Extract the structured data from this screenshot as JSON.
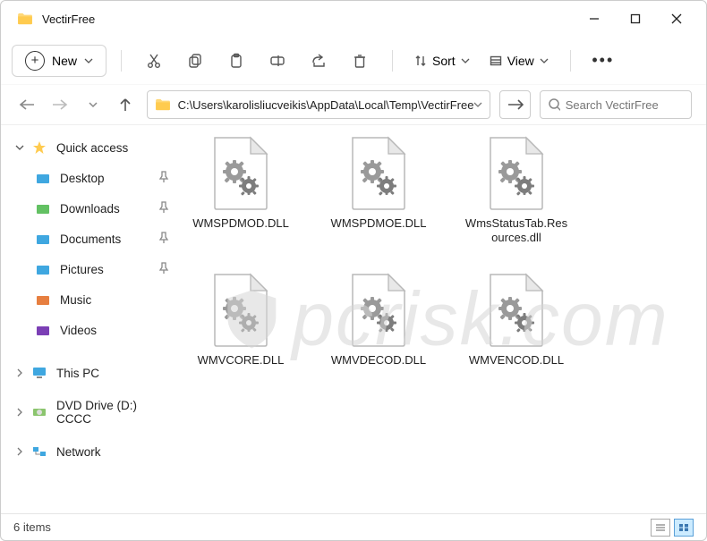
{
  "title": "VectirFree",
  "toolbar": {
    "new_label": "New",
    "sort_label": "Sort",
    "view_label": "View"
  },
  "address": "C:\\Users\\karolisliucveikis\\AppData\\Local\\Temp\\VectirFree",
  "search": {
    "placeholder": "Search VectirFree"
  },
  "sidebar": {
    "quick_access": "Quick access",
    "items": [
      {
        "label": "Desktop",
        "color": "#3fa7e0",
        "pinned": true
      },
      {
        "label": "Downloads",
        "color": "#63c163",
        "pinned": true
      },
      {
        "label": "Documents",
        "color": "#3fa7e0",
        "pinned": true
      },
      {
        "label": "Pictures",
        "color": "#3fa7e0",
        "pinned": true
      },
      {
        "label": "Music",
        "color": "#e77f40",
        "pinned": false
      },
      {
        "label": "Videos",
        "color": "#7b3fb5",
        "pinned": false
      }
    ],
    "other": [
      {
        "label": "This PC",
        "icon": "pc"
      },
      {
        "label": "DVD Drive (D:) CCCC",
        "icon": "dvd"
      },
      {
        "label": "Network",
        "icon": "net"
      }
    ]
  },
  "files": [
    {
      "name": "WMSPDMOD.DLL"
    },
    {
      "name": "WMSPDMOE.DLL"
    },
    {
      "name": "WmsStatusTab.Resources.dll"
    },
    {
      "name": "WMVCORE.DLL"
    },
    {
      "name": "WMVDECOD.DLL"
    },
    {
      "name": "WMVENCOD.DLL"
    }
  ],
  "status": {
    "items": "6 items"
  },
  "watermark": "pcrisk.com"
}
